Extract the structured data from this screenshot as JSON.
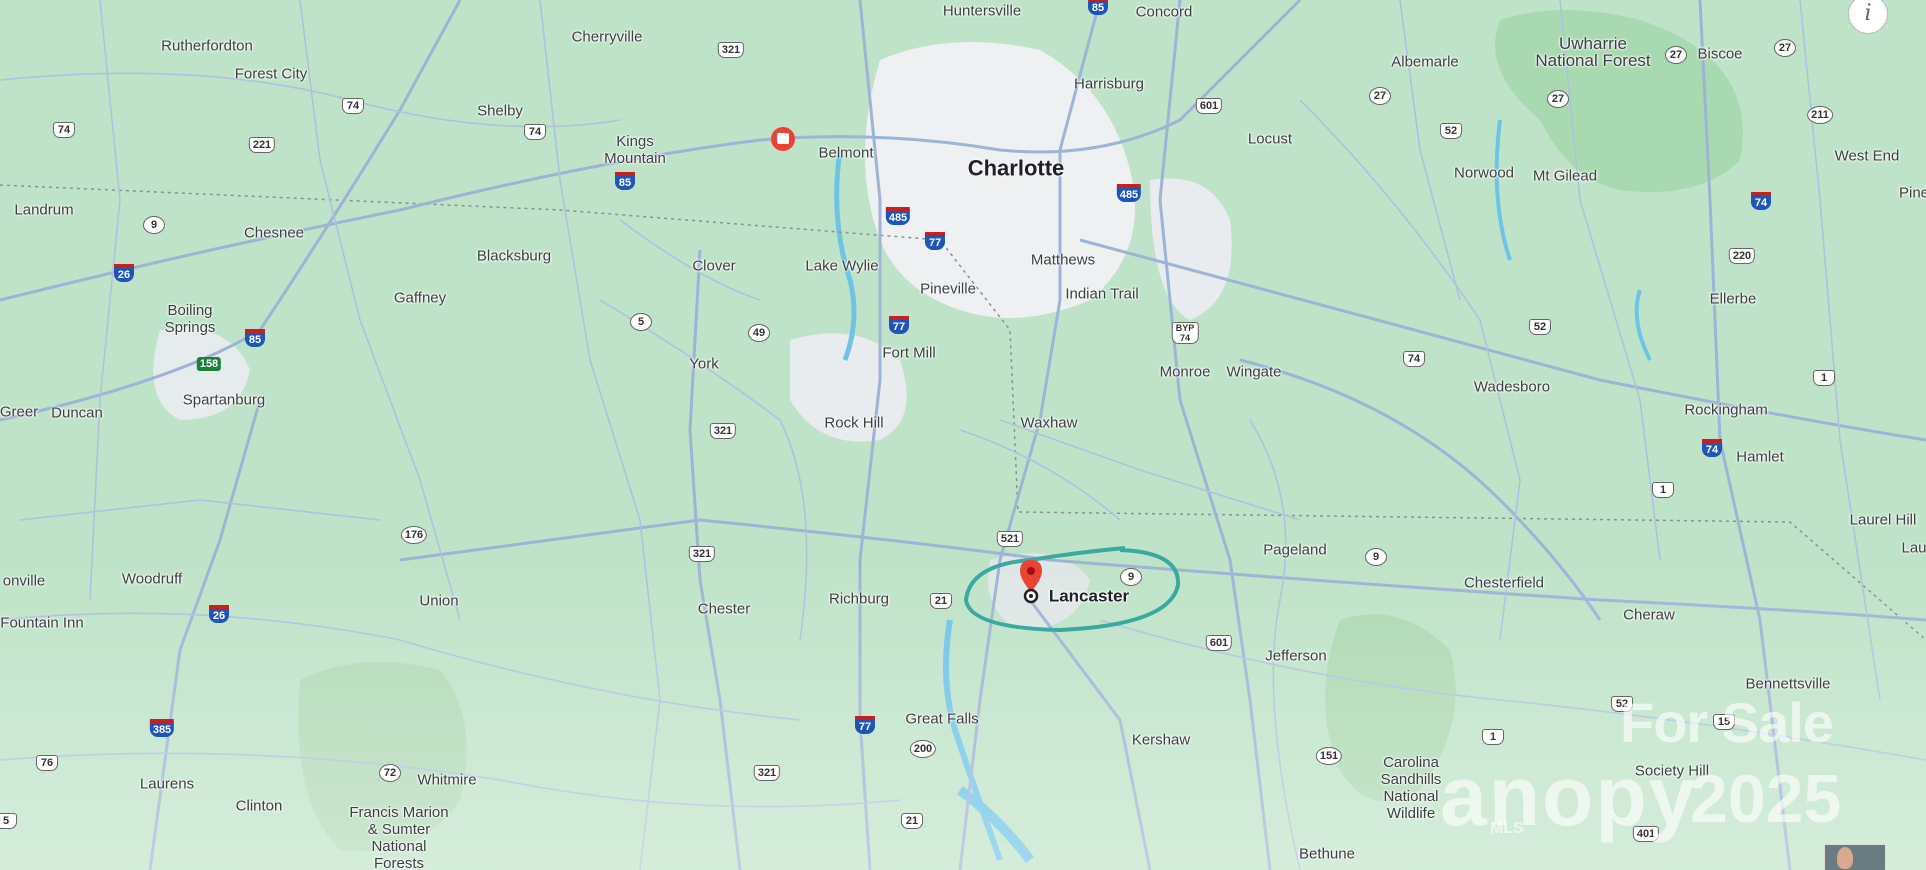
{
  "map": {
    "title_city": "Charlotte",
    "highlight_city": "Lancaster",
    "labels": [
      {
        "id": "huntersville",
        "text": "Huntersville"
      },
      {
        "id": "concord",
        "text": "Concord"
      },
      {
        "id": "cherryville",
        "text": "Cherryville"
      },
      {
        "id": "rutherfordton",
        "text": "Rutherfordton"
      },
      {
        "id": "forest-city",
        "text": "Forest City"
      },
      {
        "id": "shelby",
        "text": "Shelby"
      },
      {
        "id": "kings-mountain",
        "text": "Kings\nMountain"
      },
      {
        "id": "belmont",
        "text": "Belmont"
      },
      {
        "id": "harrisburg",
        "text": "Harrisburg"
      },
      {
        "id": "albemarle",
        "text": "Albemarle"
      },
      {
        "id": "uwharrie",
        "text": "Uwharrie\nNational Forest"
      },
      {
        "id": "biscoe",
        "text": "Biscoe"
      },
      {
        "id": "locust",
        "text": "Locust"
      },
      {
        "id": "norwood",
        "text": "Norwood"
      },
      {
        "id": "mt-gilead",
        "text": "Mt Gilead"
      },
      {
        "id": "west-end",
        "text": "West End"
      },
      {
        "id": "pine",
        "text": "Pine"
      },
      {
        "id": "landrum",
        "text": "Landrum"
      },
      {
        "id": "chesnee",
        "text": "Chesnee"
      },
      {
        "id": "blacksburg",
        "text": "Blacksburg"
      },
      {
        "id": "clover",
        "text": "Clover"
      },
      {
        "id": "lake-wylie",
        "text": "Lake Wylie"
      },
      {
        "id": "matthews",
        "text": "Matthews"
      },
      {
        "id": "pineville",
        "text": "Pineville"
      },
      {
        "id": "indian-trail",
        "text": "Indian Trail"
      },
      {
        "id": "gaffney",
        "text": "Gaffney"
      },
      {
        "id": "boiling-springs",
        "text": "Boiling\nSprings"
      },
      {
        "id": "ellerbe",
        "text": "Ellerbe"
      },
      {
        "id": "york",
        "text": "York"
      },
      {
        "id": "fort-mill",
        "text": "Fort Mill"
      },
      {
        "id": "monroe",
        "text": "Monroe"
      },
      {
        "id": "wingate",
        "text": "Wingate"
      },
      {
        "id": "wadesboro",
        "text": "Wadesboro"
      },
      {
        "id": "spartanburg",
        "text": "Spartanburg"
      },
      {
        "id": "greer",
        "text": "Greer"
      },
      {
        "id": "duncan",
        "text": "Duncan"
      },
      {
        "id": "rockingham",
        "text": "Rockingham"
      },
      {
        "id": "rock-hill",
        "text": "Rock Hill"
      },
      {
        "id": "waxhaw",
        "text": "Waxhaw"
      },
      {
        "id": "hamlet",
        "text": "Hamlet"
      },
      {
        "id": "laurel-hill",
        "text": "Laurel Hill"
      },
      {
        "id": "lau",
        "text": "Lau"
      },
      {
        "id": "pageland",
        "text": "Pageland"
      },
      {
        "id": "onville",
        "text": "onville"
      },
      {
        "id": "woodruff",
        "text": "Woodruff"
      },
      {
        "id": "chesterfield",
        "text": "Chesterfield"
      },
      {
        "id": "union",
        "text": "Union"
      },
      {
        "id": "chester",
        "text": "Chester"
      },
      {
        "id": "richburg",
        "text": "Richburg"
      },
      {
        "id": "cheraw",
        "text": "Cheraw"
      },
      {
        "id": "fountain-inn",
        "text": "Fountain Inn"
      },
      {
        "id": "jefferson",
        "text": "Jefferson"
      },
      {
        "id": "bennettsville",
        "text": "Bennettsville"
      },
      {
        "id": "great-falls",
        "text": "Great Falls"
      },
      {
        "id": "kershaw",
        "text": "Kershaw"
      },
      {
        "id": "carolina-sandhills",
        "text": "Carolina\nSandhills\nNational\nWildlife"
      },
      {
        "id": "society-hill",
        "text": "Society Hill"
      },
      {
        "id": "laurens",
        "text": "Laurens"
      },
      {
        "id": "whitmire",
        "text": "Whitmire"
      },
      {
        "id": "clinton",
        "text": "Clinton"
      },
      {
        "id": "francis-marion",
        "text": "Francis Marion\n& Sumter\nNational\nForests"
      },
      {
        "id": "bethune",
        "text": "Bethune"
      }
    ],
    "shields": [
      {
        "id": "s-85-top",
        "text": "85",
        "kind": "i"
      },
      {
        "id": "s-321-a",
        "text": "321",
        "kind": "us"
      },
      {
        "id": "s-74-a",
        "text": "74",
        "kind": "us"
      },
      {
        "id": "s-74-b",
        "text": "74",
        "kind": "us"
      },
      {
        "id": "s-74-c",
        "text": "74",
        "kind": "us"
      },
      {
        "id": "s-221",
        "text": "221",
        "kind": "us"
      },
      {
        "id": "s-85-b",
        "text": "85",
        "kind": "i"
      },
      {
        "id": "s-601-a",
        "text": "601",
        "kind": "us"
      },
      {
        "id": "s-27-a",
        "text": "27",
        "kind": "st"
      },
      {
        "id": "s-27-b",
        "text": "27",
        "kind": "st"
      },
      {
        "id": "s-27-c",
        "text": "27",
        "kind": "st"
      },
      {
        "id": "s-27-d",
        "text": "27",
        "kind": "st"
      },
      {
        "id": "s-52-a",
        "text": "52",
        "kind": "us"
      },
      {
        "id": "s-211",
        "text": "211",
        "kind": "st"
      },
      {
        "id": "s-485-a",
        "text": "485",
        "kind": "i"
      },
      {
        "id": "s-485-b",
        "text": "485",
        "kind": "i"
      },
      {
        "id": "s-77-a",
        "text": "77",
        "kind": "i"
      },
      {
        "id": "s-74-d",
        "text": "74",
        "kind": "i"
      },
      {
        "id": "s-9-a",
        "text": "9",
        "kind": "st"
      },
      {
        "id": "s-26-a",
        "text": "26",
        "kind": "i"
      },
      {
        "id": "s-220",
        "text": "220",
        "kind": "us"
      },
      {
        "id": "s-5",
        "text": "5",
        "kind": "st"
      },
      {
        "id": "s-85-c",
        "text": "85",
        "kind": "i"
      },
      {
        "id": "s-49",
        "text": "49",
        "kind": "st"
      },
      {
        "id": "s-77-b",
        "text": "77",
        "kind": "i"
      },
      {
        "id": "s-byp",
        "text": "BYP\n74",
        "kind": "us"
      },
      {
        "id": "s-52-b",
        "text": "52",
        "kind": "us"
      },
      {
        "id": "s-158",
        "text": "158",
        "kind": "green"
      },
      {
        "id": "s-74-e",
        "text": "74",
        "kind": "us"
      },
      {
        "id": "s-1-a",
        "text": "1",
        "kind": "us"
      },
      {
        "id": "s-321-b",
        "text": "321",
        "kind": "us"
      },
      {
        "id": "s-74-f",
        "text": "74",
        "kind": "us"
      },
      {
        "id": "s-1-b",
        "text": "1",
        "kind": "us"
      },
      {
        "id": "s-176",
        "text": "176",
        "kind": "st"
      },
      {
        "id": "s-521",
        "text": "521",
        "kind": "us"
      },
      {
        "id": "s-321-c",
        "text": "321",
        "kind": "us"
      },
      {
        "id": "s-9-b",
        "text": "9",
        "kind": "st"
      },
      {
        "id": "s-9-c",
        "text": "9",
        "kind": "st"
      },
      {
        "id": "s-21-a",
        "text": "21",
        "kind": "us"
      },
      {
        "id": "s-26-b",
        "text": "26",
        "kind": "i"
      },
      {
        "id": "s-601-b",
        "text": "601",
        "kind": "us"
      },
      {
        "id": "s-52-c",
        "text": "52",
        "kind": "us"
      },
      {
        "id": "s-15",
        "text": "15",
        "kind": "us"
      },
      {
        "id": "s-385",
        "text": "385",
        "kind": "i"
      },
      {
        "id": "s-77-c",
        "text": "77",
        "kind": "i"
      },
      {
        "id": "s-200",
        "text": "200",
        "kind": "st"
      },
      {
        "id": "s-1-c",
        "text": "1",
        "kind": "us"
      },
      {
        "id": "s-76",
        "text": "76",
        "kind": "us"
      },
      {
        "id": "s-72",
        "text": "72",
        "kind": "st"
      },
      {
        "id": "s-321-d",
        "text": "321",
        "kind": "us"
      },
      {
        "id": "s-151",
        "text": "151",
        "kind": "st"
      },
      {
        "id": "s-401",
        "text": "401",
        "kind": "us"
      },
      {
        "id": "s-21-b",
        "text": "21",
        "kind": "us"
      },
      {
        "id": "s-5-b",
        "text": "5",
        "kind": "us"
      }
    ],
    "colors": {
      "land": "#bfe3c8",
      "urban": "#eef0f2",
      "road": "#9fb3d6",
      "water": "#6fc4e6",
      "forest": "#a6d6ad",
      "circle": "#3aa99f",
      "pin": "#ea4335"
    }
  },
  "controls": {
    "info_button": "i"
  },
  "watermark": {
    "line1": "For Sale",
    "line2": "anopy",
    "line3": "2025",
    "sub": "MLS"
  }
}
